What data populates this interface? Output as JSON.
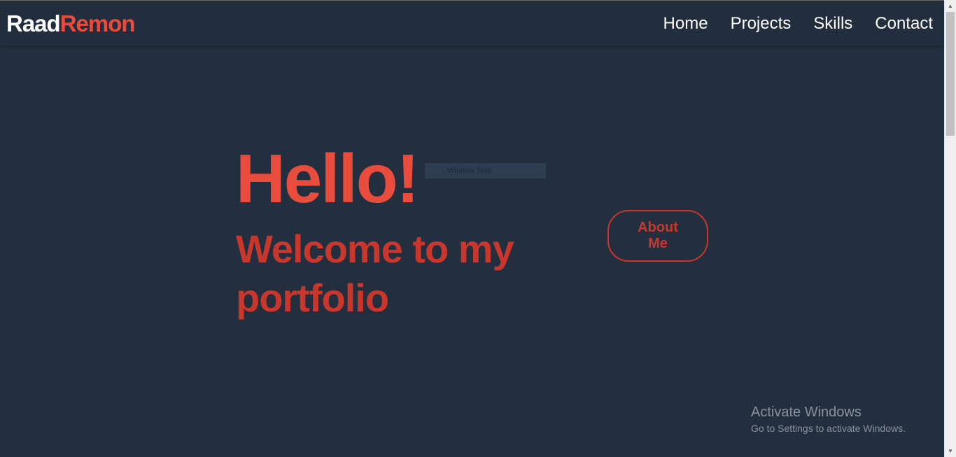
{
  "header": {
    "logo_first": "Raad",
    "logo_last": "Remon",
    "nav": [
      {
        "label": "Home"
      },
      {
        "label": "Projects"
      },
      {
        "label": "Skills"
      },
      {
        "label": "Contact"
      }
    ]
  },
  "hero": {
    "greeting": "Hello!",
    "subtitle": "Welcome to my portfolio",
    "about_button": "About Me"
  },
  "overlay": {
    "snip_label": "Window Snip"
  },
  "watermark": {
    "title": "Activate Windows",
    "subtitle": "Go to Settings to activate Windows."
  },
  "colors": {
    "background": "#232f3f",
    "accent": "#e84c3d",
    "accent_dark": "#c9372c",
    "nav_text": "#ffffff"
  },
  "icons": {
    "scroll_up": "scroll-up-arrow-icon",
    "scroll_down": "scroll-down-arrow-icon"
  }
}
